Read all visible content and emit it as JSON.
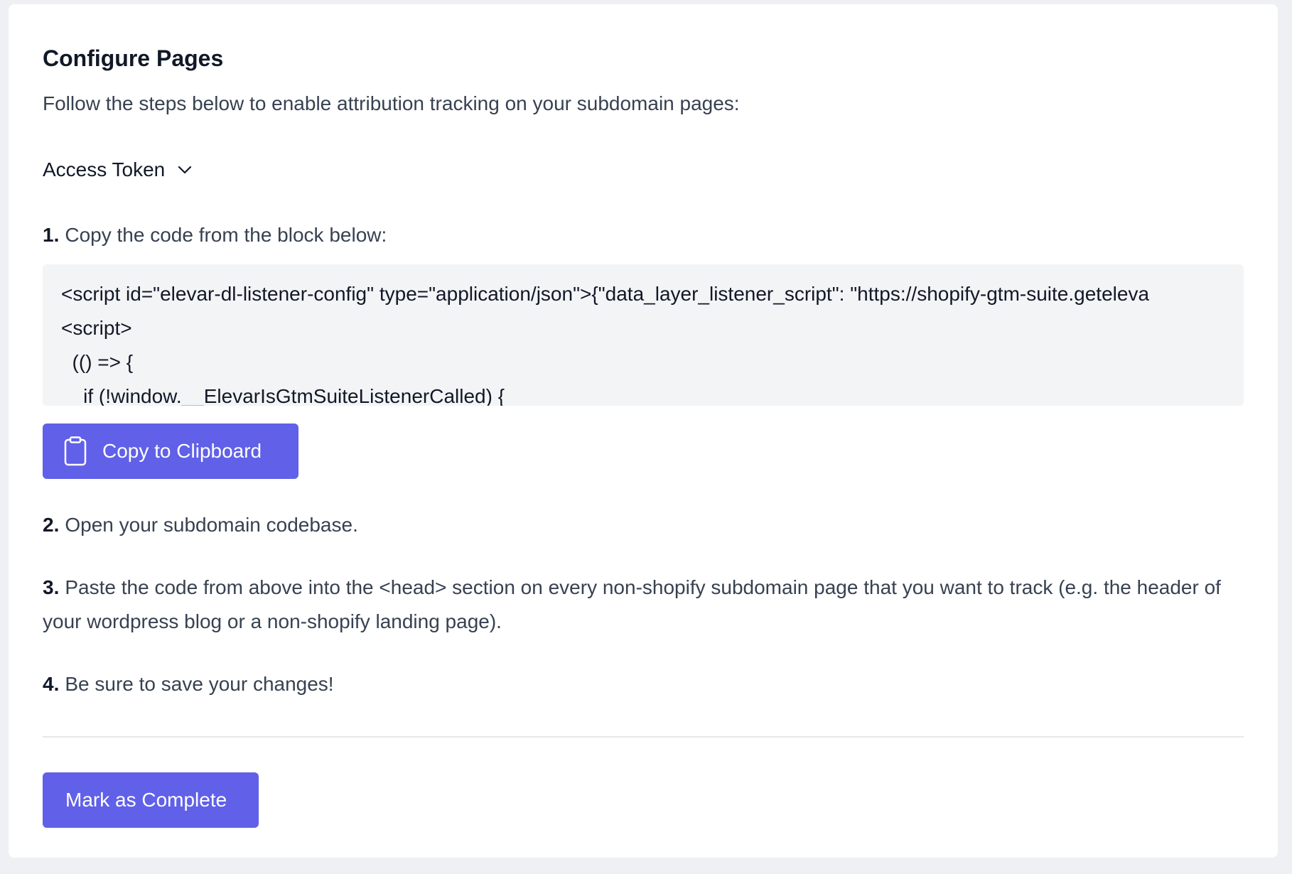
{
  "header": {
    "title": "Configure Pages",
    "subtitle": "Follow the steps below to enable attribution tracking on your subdomain pages:"
  },
  "token_toggle": {
    "label": "Access Token",
    "icon": "chevron-down-icon"
  },
  "steps": [
    {
      "num": "1.",
      "text": "Copy the code from the block below:"
    },
    {
      "num": "2.",
      "text": "Open your subdomain codebase."
    },
    {
      "num": "3.",
      "text": "Paste the code from above into the <head> section on every non-shopify subdomain page that you want to track (e.g. the header of your wordpress blog or a non-shopify landing page)."
    },
    {
      "num": "4.",
      "text": "Be sure to save your changes!"
    }
  ],
  "code_block": {
    "lines": [
      "<script id=\"elevar-dl-listener-config\" type=\"application/json\">{\"data_layer_listener_script\": \"https://shopify-gtm-suite.geteleva",
      "<script>",
      "  (() => {",
      "    if (!window.__ElevarIsGtmSuiteListenerCalled) {"
    ]
  },
  "buttons": {
    "copy_label": "Copy to Clipboard",
    "copy_icon": "clipboard-icon",
    "complete_label": "Mark as Complete"
  },
  "colors": {
    "primary": "#6060e8",
    "background": "#eef0f3",
    "card": "#ffffff",
    "code_bg": "#f3f4f6"
  }
}
